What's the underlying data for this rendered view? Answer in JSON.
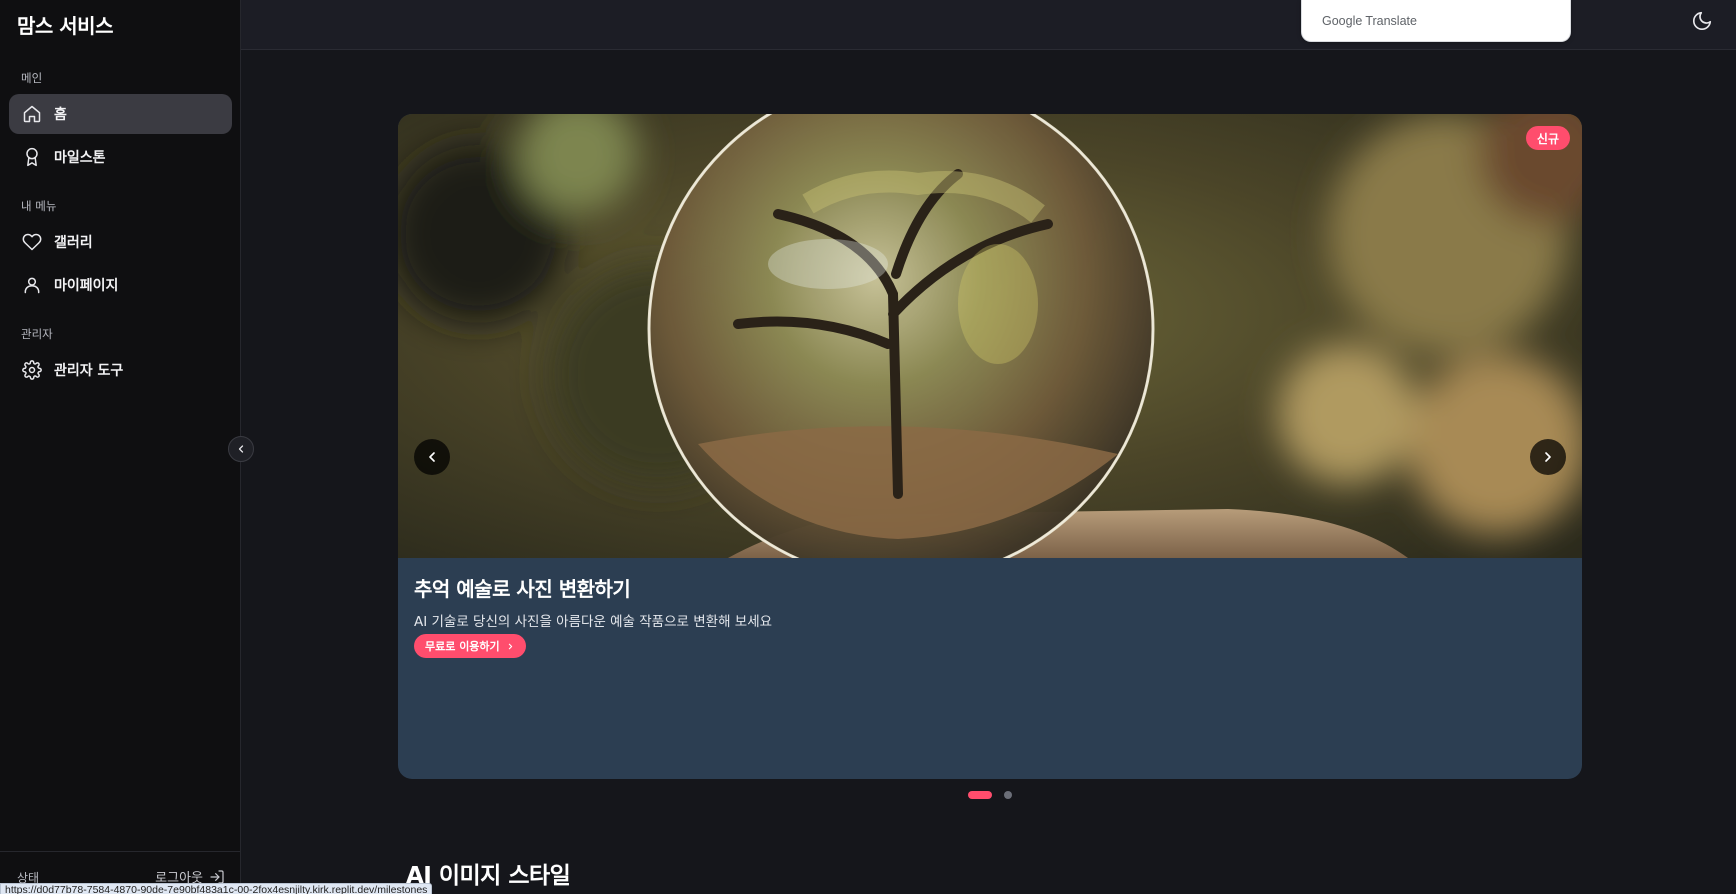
{
  "sidebar": {
    "brand": "맘스 서비스",
    "sections": {
      "main": "메인",
      "my_menu": "내 메뉴",
      "admin": "관리자"
    },
    "items": [
      {
        "label": "홈",
        "icon": "home-icon",
        "active": true
      },
      {
        "label": "마일스톤",
        "icon": "award-icon",
        "active": false
      },
      {
        "label": "갤러리",
        "icon": "heart-icon",
        "active": false
      },
      {
        "label": "마이페이지",
        "icon": "user-icon",
        "active": false
      },
      {
        "label": "관리자 도구",
        "icon": "gear-icon",
        "active": false
      }
    ],
    "status_label": "상태",
    "logout_label": "로그아웃"
  },
  "topbar": {
    "translate_google": "Google",
    "translate_label": "Translate",
    "theme_icon": "moon-icon"
  },
  "carousel": {
    "badge": "신규",
    "slide_title": "추억 예술로 사진 변환하기",
    "slide_desc": "AI 기술로 당신의 사진을 아름다운 예술 작품으로 변환해 보세요",
    "cta_label": "무료로 이용하기",
    "slide_count": 2,
    "active_slide": 1
  },
  "section": {
    "title": "AI 이미지 스타일"
  },
  "status_url": "https://d0d77b78-7584-4870-90de-7e90bf483a1c-00-2fox4esnjilty.kirk.replit.dev/milestones",
  "colors": {
    "accent": "#ff4d6d",
    "sidebar_bg": "#0f0f11",
    "page_bg": "#15161b",
    "card_bg": "#2c3e52",
    "active_nav": "#3b3b42"
  }
}
